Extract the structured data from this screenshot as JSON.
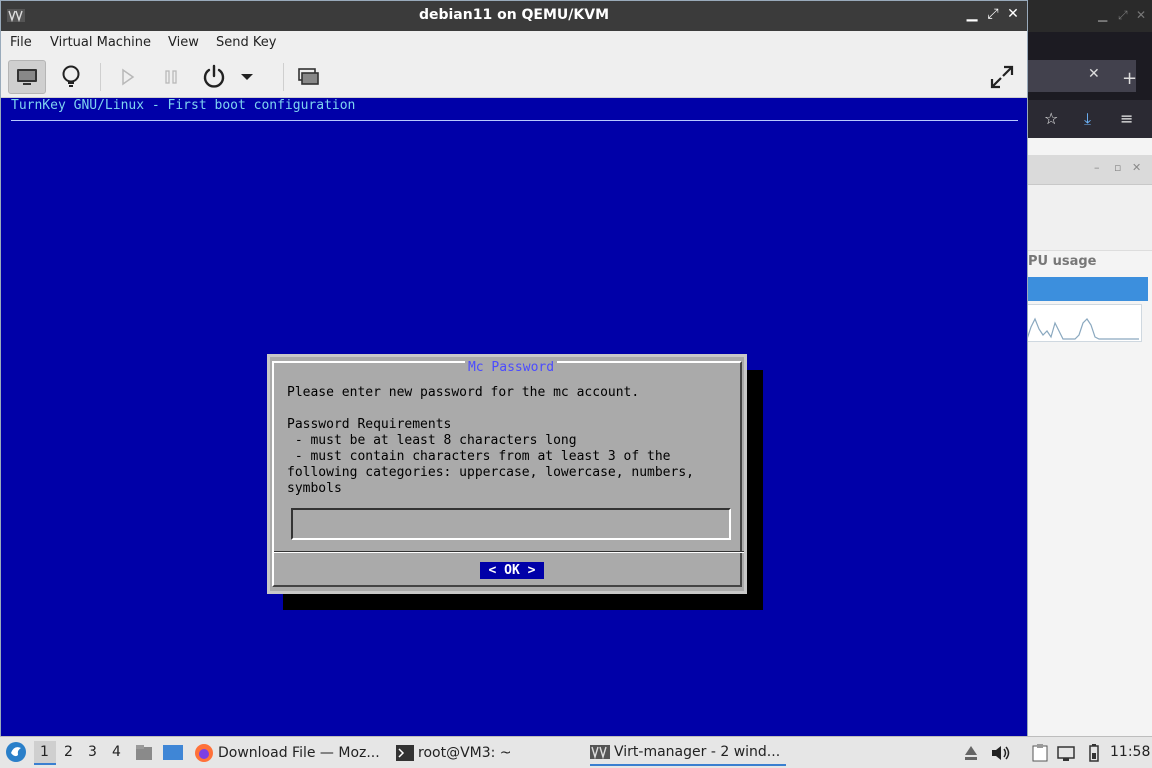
{
  "window": {
    "title": "debian11 on QEMU/KVM",
    "minimize": "▁",
    "restore": "⤢",
    "close": "✕"
  },
  "menu": [
    "File",
    "Virtual Machine",
    "View",
    "Send Key"
  ],
  "console": {
    "header": "TurnKey GNU/Linux - First boot configuration"
  },
  "dialog": {
    "title": "Mc Password",
    "prompt": "Please enter new password for the mc account.",
    "requirements_heading": "Password Requirements",
    "req1": " - must be at least 8 characters long",
    "req2": " - must contain characters from at least 3 of the",
    "req3": "following categories: uppercase, lowercase, numbers,",
    "req4": "symbols",
    "password_value": "",
    "ok_label": "<  OK  >"
  },
  "background_window": {
    "cpu_label": "PU usage"
  },
  "taskbar": {
    "workspaces": [
      "1",
      "2",
      "3",
      "4"
    ],
    "tasks": [
      {
        "label": "Download File — Moz..."
      },
      {
        "label": "root@VM3: ~"
      },
      {
        "label": "Virt-manager - 2 wind..."
      }
    ],
    "clock": "11:58"
  },
  "colors": {
    "console_bg": "#0000a8",
    "dialog_bg": "#aaaaaa",
    "accent": "#3a7fd0"
  }
}
